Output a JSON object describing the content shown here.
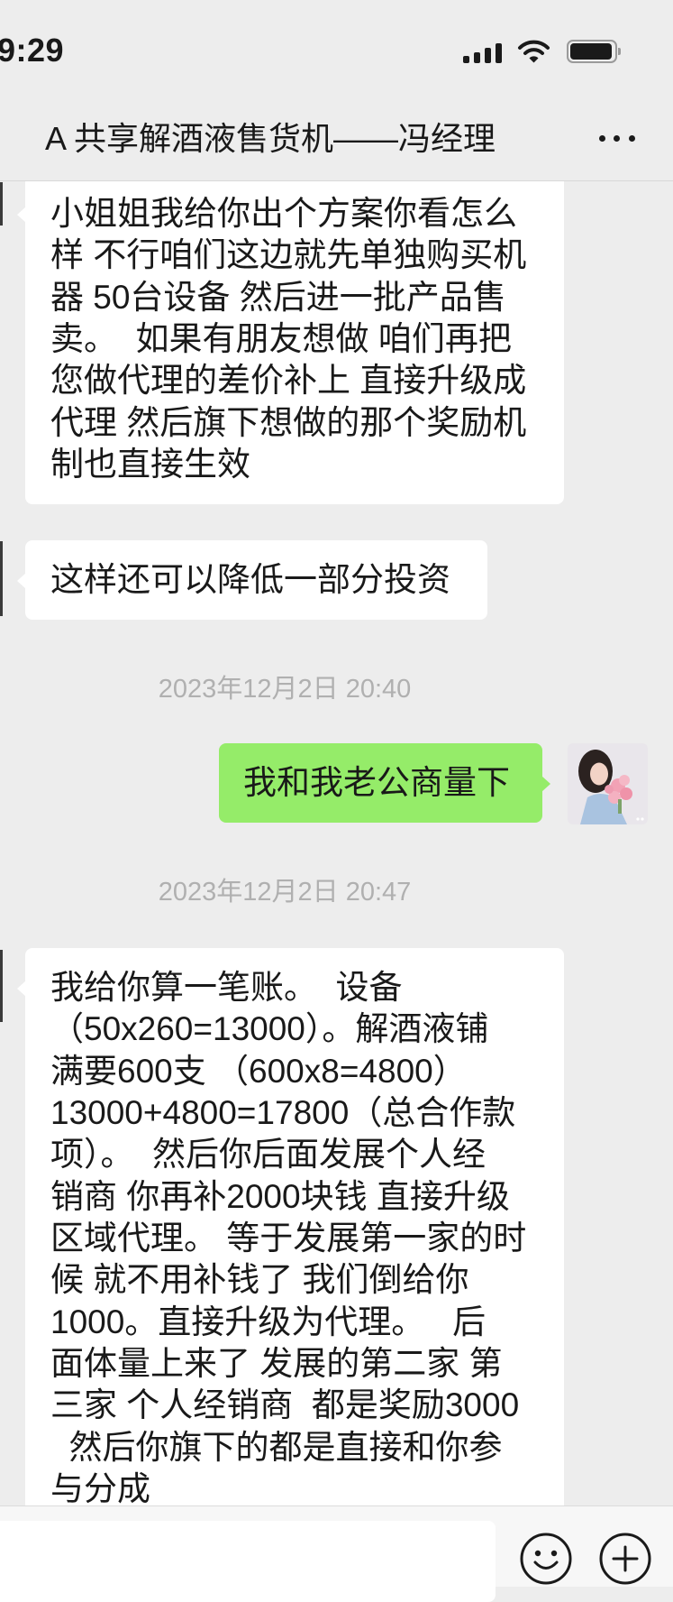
{
  "status_bar": {
    "time": "9:29"
  },
  "nav": {
    "title": "A 共享解酒液售货机——冯经理"
  },
  "chat": {
    "msg1": {
      "lines": [
        "小姐姐我给你出个方案你看怎么",
        "样 不行咱们这边就先单独购买机",
        "器 50台设备 然后进一批产品售",
        "卖。  如果有朋友想做 咱们再把",
        "您做代理的差价补上 直接升级成",
        "代理 然后旗下想做的那个奖励机",
        "制也直接生效"
      ]
    },
    "msg2": {
      "lines": [
        "这样还可以降低一部分投资"
      ]
    },
    "time1": "2023年12月2日 20:40",
    "msg3": {
      "lines": [
        "我和我老公商量下"
      ]
    },
    "time2": "2023年12月2日 20:47",
    "msg4": {
      "lines": [
        "我给你算一笔账。  设备",
        "（50x260=13000）。解酒液铺",
        "满要600支 （600x8=4800）",
        "13000+4800=17800（总合作款",
        "项）。  然后你后面发展个人经",
        "销商 你再补2000块钱 直接升级",
        "区域代理。 等于发展第一家的时",
        "候 就不用补钱了 我们倒给你",
        "1000。直接升级为代理。   后",
        "面体量上来了 发展的第二家 第",
        "三家 个人经销商  都是奖励3000",
        "  然后你旗下的都是直接和你参",
        "与分成"
      ]
    }
  },
  "icons": {
    "signal": "cellular-signal-icon",
    "wifi": "wifi-icon",
    "battery": "battery-icon",
    "more": "more-dots-icon",
    "emoji": "emoji-icon",
    "plus": "plus-icon"
  },
  "colors": {
    "chat_bg": "#ededed",
    "received_bubble": "#ffffff",
    "sent_bubble": "#95ec69",
    "timestamp_text": "#b0b0b0"
  }
}
